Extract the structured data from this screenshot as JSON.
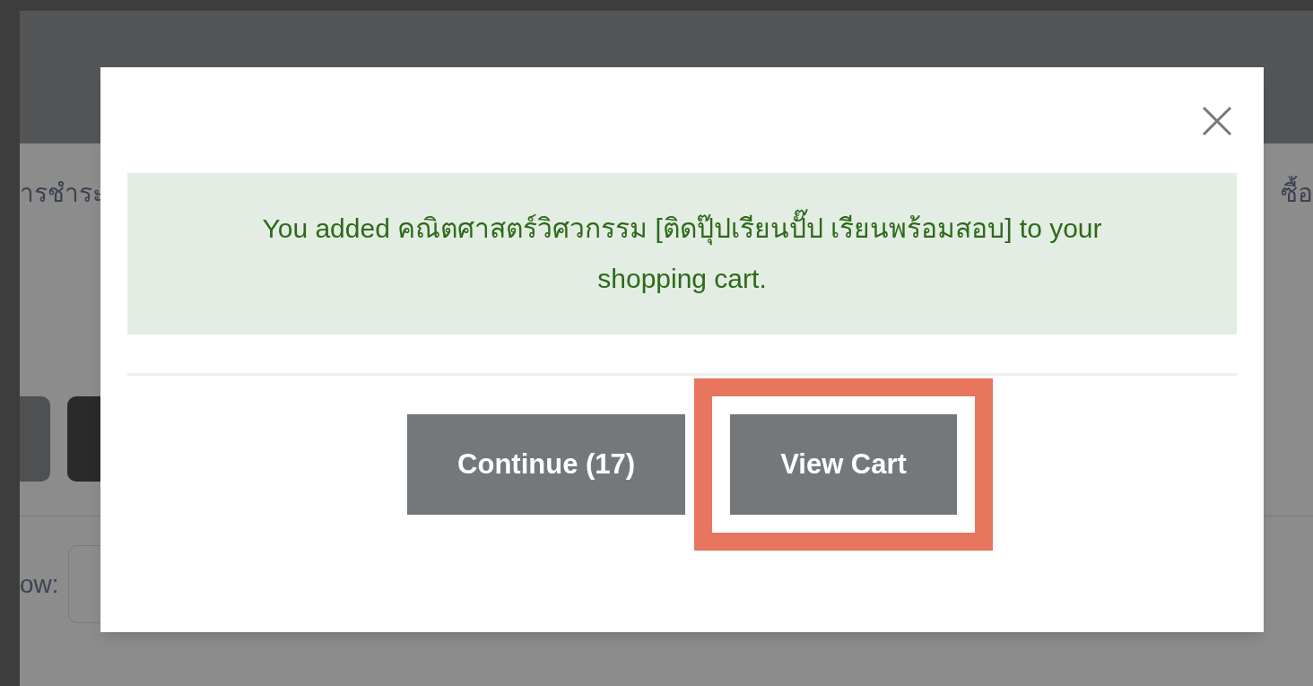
{
  "background_page": {
    "left_text": "ารชำระ",
    "right_text": "ซื้อ",
    "show_label": "ow:"
  },
  "dialog": {
    "message": "You added คณิตศาสตร์วิศวกรรม [ติดปุ๊ปเรียนปั๊ป เรียนพร้อมสอบ] to your shopping cart.",
    "buttons": [
      {
        "label": "Continue (17)",
        "highlighted": false
      },
      {
        "label": "View Cart",
        "highlighted": true
      }
    ]
  }
}
